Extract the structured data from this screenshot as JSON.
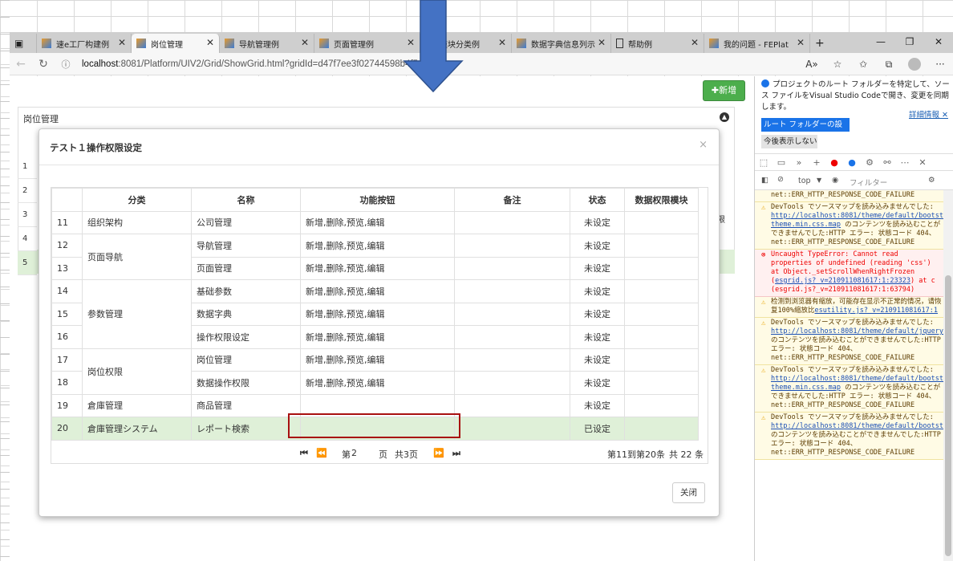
{
  "browser": {
    "tabs": [
      {
        "label": "速e工厂构建例",
        "icon": "fes-icon"
      },
      {
        "label": "岗位管理",
        "icon": "fes-icon"
      },
      {
        "label": "导航管理例",
        "icon": "fes-icon"
      },
      {
        "label": "页面管理例",
        "icon": "fes-icon"
      },
      {
        "label": "模块分类例",
        "icon": "fes-icon"
      },
      {
        "label": "数据字典信息列示",
        "icon": "fes-icon"
      },
      {
        "label": "帮助例",
        "icon": "page-icon"
      },
      {
        "label": "我的问题 - FEPlat",
        "icon": "fes-icon"
      }
    ],
    "url_host": "localhost",
    "url_rest": ":8081/Platform/UIV2/Grid/ShowGrid.html?gridId=d47f7ee3f02744598b4f5"
  },
  "page": {
    "add_label": "新增",
    "panel_title": "岗位管理",
    "row_numbers": [
      "1",
      "2",
      "3",
      "4",
      "5"
    ],
    "header_fragment": "限"
  },
  "modal": {
    "title": "テスト１操作权限设定",
    "columns": [
      "",
      "分类",
      "名称",
      "功能按钮",
      "备注",
      "状态",
      "数据权限模块"
    ],
    "rows": [
      {
        "no": "11",
        "category": "组织架构",
        "name": "公司管理",
        "buttons": "新增,删除,预览,编辑",
        "remark": "",
        "status": "未设定",
        "module": ""
      },
      {
        "no": "12",
        "category": "页面导航",
        "name": "导航管理",
        "buttons": "新增,删除,预览,编辑",
        "remark": "",
        "status": "未设定",
        "module": ""
      },
      {
        "no": "13",
        "category": "",
        "name": "页面管理",
        "buttons": "新增,删除,预览,编辑",
        "remark": "",
        "status": "未设定",
        "module": ""
      },
      {
        "no": "14",
        "category": "参数管理",
        "name": "基础参数",
        "buttons": "新增,删除,预览,编辑",
        "remark": "",
        "status": "未设定",
        "module": ""
      },
      {
        "no": "15",
        "category": "",
        "name": "数据字典",
        "buttons": "新增,删除,预览,编辑",
        "remark": "",
        "status": "未设定",
        "module": ""
      },
      {
        "no": "16",
        "category": "",
        "name": "操作权限设定",
        "buttons": "新增,删除,预览,编辑",
        "remark": "",
        "status": "未设定",
        "module": ""
      },
      {
        "no": "17",
        "category": "岗位权限",
        "name": "岗位管理",
        "buttons": "新增,删除,预览,编辑",
        "remark": "",
        "status": "未设定",
        "module": ""
      },
      {
        "no": "18",
        "category": "",
        "name": "数据操作权限",
        "buttons": "新增,删除,预览,编辑",
        "remark": "",
        "status": "未设定",
        "module": ""
      },
      {
        "no": "19",
        "category": "倉庫管理",
        "name": "商品管理",
        "buttons": "",
        "remark": "",
        "status": "未设定",
        "module": ""
      },
      {
        "no": "20",
        "category": "倉庫管理システム",
        "name": "レポート検索",
        "buttons": "",
        "remark": "",
        "status": "已设定",
        "module": ""
      }
    ],
    "selected_row": "20",
    "pager": {
      "page_prefix": "第",
      "page": "2",
      "page_mid": "页",
      "total_pages": "共3页",
      "range": "第11到第20条",
      "total": "共 22 条"
    },
    "close_label": "关闭"
  },
  "devtools": {
    "notice": "プロジェクトのルート フォルダーを特定して、ソース ファイルをVisual Studio Codeで開き、変更を同期します。",
    "notice_link": "詳細情報",
    "set_root": "ルート フォルダーの設定",
    "hide": "今後表示しない",
    "context": "top",
    "filter_placeholder": "フィルター",
    "messages": [
      {
        "type": "warn",
        "text": "net::ERR_HTTP_RESPONSE_CODE_FAILURE",
        "link": "",
        "tail": ""
      },
      {
        "type": "warn",
        "text": "DevTools でソースマップを読み込みませんでした: ",
        "link": "http://localhost:8081/theme/default/bootstrap-theme.min.css.map",
        "tail": " のコンテンツを読み込むことができませんでした:HTTP エラー: 状態コード 404、net::ERR_HTTP_RESPONSE_CODE_FAILURE"
      },
      {
        "type": "err",
        "text": "Uncaught TypeError: Cannot read properties of undefined (reading 'css') at Object._setScrollWhenRightFrozen (",
        "link": "esgrid.js?_v=210911081617:1:23323",
        "tail": ") at c (esgrid.js?_v=210911081617:1:63794)"
      },
      {
        "type": "warn",
        "text": "检测到浏览器有缩放，可能存在显示不正常的情况，请恢复100%缩放比",
        "link": "esutility.js?_v=210911081617:1",
        "tail": ""
      },
      {
        "type": "warn",
        "text": "DevTools でソースマップを読み込みませんでした: ",
        "link": "http://localhost:8081/theme/default/jquery.contextMenu.min.css.map",
        "tail": " のコンテンツを読み込むことができませんでした:HTTP エラー: 状態コード 404、net::ERR_HTTP_RESPONSE_CODE_FAILURE"
      },
      {
        "type": "warn",
        "text": "DevTools でソースマップを読み込みませんでした: ",
        "link": "http://localhost:8081/theme/default/bootstrap-theme.min.css.map",
        "tail": " のコンテンツを読み込むことができませんでした:HTTP エラー: 状態コード 404、net::ERR_HTTP_RESPONSE_CODE_FAILURE"
      },
      {
        "type": "warn",
        "text": "DevTools でソースマップを読み込みませんでした: ",
        "link": "http://localhost:8081/theme/default/bootstrap.min.css.map",
        "tail": " のコンテンツを読み込むことができませんでした:HTTP エラー: 状態コード 404、net::ERR_HTTP_RESPONSE_CODE_FAILURE"
      }
    ]
  },
  "colors": {
    "add_green": "#4cae4c",
    "selected_row": "#dff0d8",
    "highlight_border": "#a81010",
    "arrow_blue": "#4472c4"
  }
}
